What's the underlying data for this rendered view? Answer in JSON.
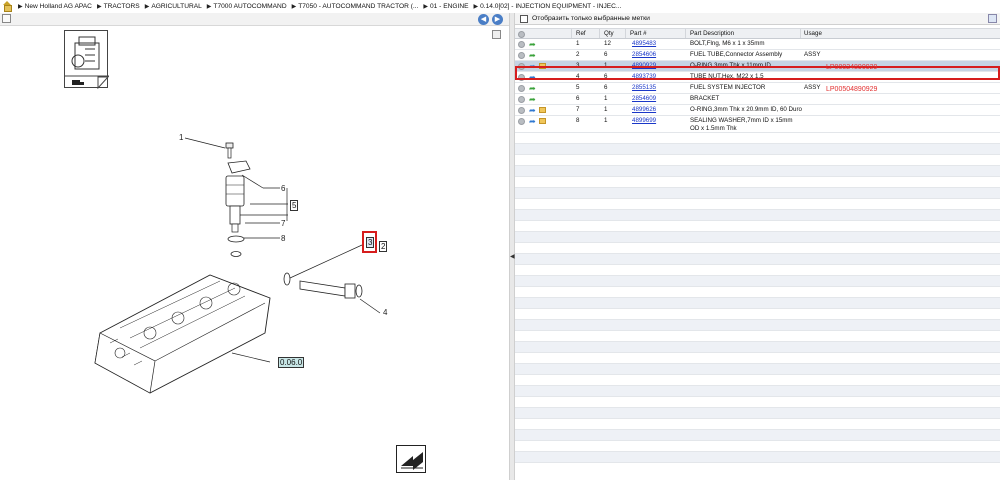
{
  "breadcrumb": {
    "items": [
      "New Holland AG APAC",
      "TRACTORS",
      "AGRICULTURAL",
      "T7000 AUTOCOMMAND",
      "T7050 - AUTOCOMMAND TRACTOR (...",
      "01 - ENGINE",
      "0.14.0[02] - INJECTION EQUIPMENT - INJEC..."
    ]
  },
  "filter": {
    "label": "Отобразить только выбранные метки"
  },
  "table": {
    "headers": {
      "ref": "Ref",
      "qty": "Qty",
      "part": "Part #",
      "desc": "Part Description",
      "usage": "Usage"
    },
    "rows": [
      {
        "ref": "1",
        "qty": "12",
        "part": "4895483",
        "desc": "BOLT,Flng, M6 x 1 x 35mm",
        "usage": "",
        "icon": "green-arrow",
        "box": false
      },
      {
        "ref": "2",
        "qty": "6",
        "part": "2854606",
        "desc": "FUEL TUBE,Connector Assembly",
        "usage": "ASSY",
        "icon": "green-arrow",
        "box": false
      },
      {
        "ref": "3",
        "qty": "1",
        "part": "4890929",
        "desc": "O-RING,3mm Thk x 11mm ID",
        "usage": "",
        "icon": "blue-arrow",
        "box": true
      },
      {
        "ref": "4",
        "qty": "6",
        "part": "4893739",
        "desc": "TUBE NUT,Hex, M22 x 1.5",
        "usage": "",
        "icon": "blue-arrow",
        "box": false
      },
      {
        "ref": "5",
        "qty": "6",
        "part": "2855135",
        "desc": "FUEL SYSTEM INJECTOR",
        "usage": "ASSY",
        "icon": "green-arrow",
        "box": false
      },
      {
        "ref": "6",
        "qty": "1",
        "part": "2854609",
        "desc": "BRACKET",
        "usage": "",
        "icon": "green-arrow",
        "box": false
      },
      {
        "ref": "7",
        "qty": "1",
        "part": "4899626",
        "desc": "O-RING,3mm Thk x 20.9mm ID, 60 Duro",
        "usage": "",
        "icon": "blue-arrow",
        "box": true
      },
      {
        "ref": "8",
        "qty": "1",
        "part": "4899699",
        "desc": "SEALING WASHER,7mm ID x 15mm OD x 1.5mm Thk",
        "usage": "",
        "icon": "blue-arrow",
        "box": true
      }
    ]
  },
  "annotations": {
    "note1": "LP00024890929",
    "note2": "LP00504890929"
  },
  "diagram": {
    "labels": [
      "1",
      "6",
      "5",
      "7",
      "8",
      "3",
      "2",
      "4"
    ],
    "ref_box": "0.06.0"
  },
  "colors": {
    "highlight": "#d61d1d",
    "selected_row": "#c6d3e3",
    "link": "#1a37c8"
  }
}
